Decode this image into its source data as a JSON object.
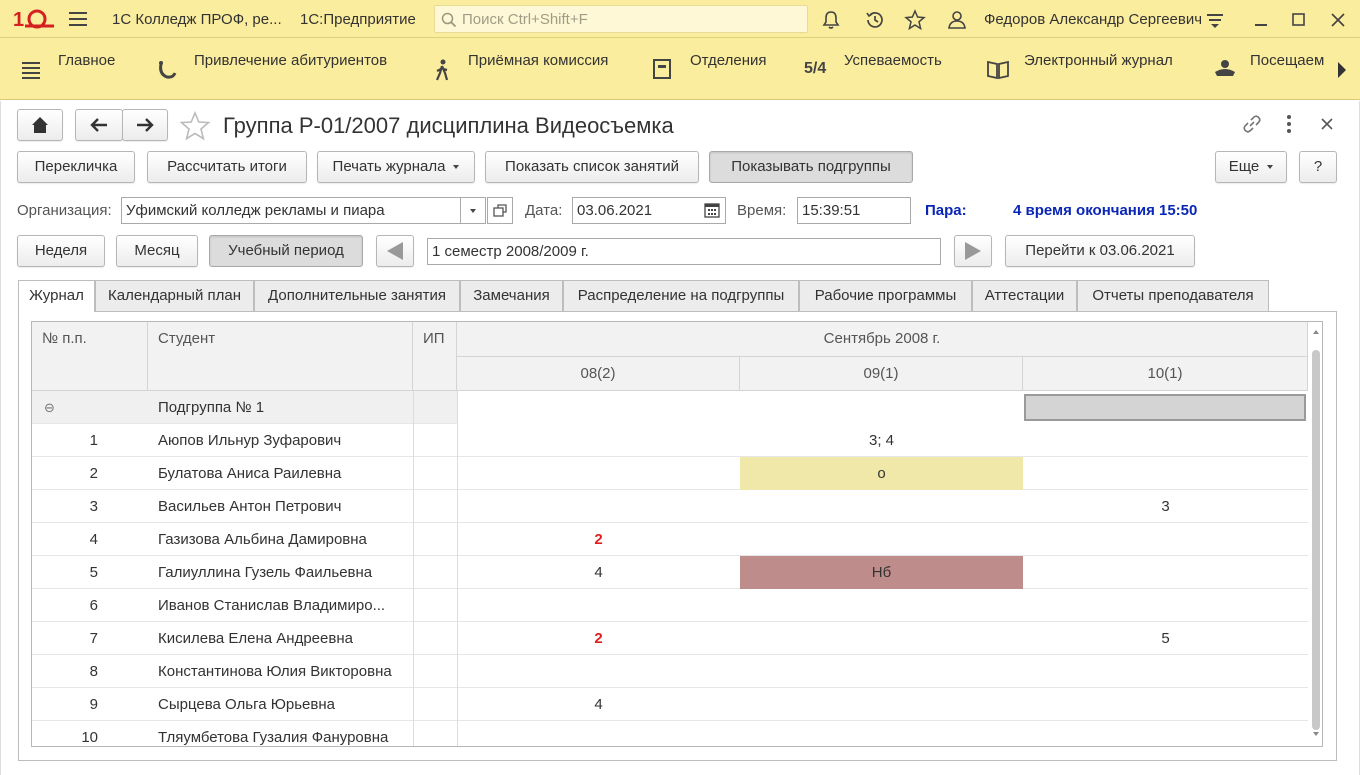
{
  "app": {
    "title": "1С Колледж ПРОФ, ре...",
    "subtitle": "1С:Предприятие",
    "search_placeholder": "Поиск Ctrl+Shift+F",
    "user": "Федоров Александр Сергеевич"
  },
  "sections": [
    {
      "label": "Главное",
      "icon": "list-icon"
    },
    {
      "label": "Привлечение абитуриентов",
      "icon": "magnet-icon"
    },
    {
      "label": "Приёмная комиссия",
      "icon": "person-walking-icon"
    },
    {
      "label": "Отделения",
      "icon": "building-icon"
    },
    {
      "label": "Успеваемость",
      "icon": "grade-icon",
      "glyph": "5/4"
    },
    {
      "label": "Электронный журнал",
      "icon": "book-icon"
    },
    {
      "label": "Посещаем",
      "icon": "hat-icon"
    }
  ],
  "form": {
    "title": "Группа Р-01/2007 дисциплина Видеосъемка",
    "buttons": {
      "rollcall": "Перекличка",
      "calc_totals": "Рассчитать итоги",
      "print_journal": "Печать журнала",
      "show_lessons": "Показать список занятий",
      "show_subgroups": "Показывать подгруппы",
      "more": "Еще",
      "help": "?"
    },
    "org_label": "Организация:",
    "org_value": "Уфимский колледж рекламы и пиара",
    "date_label": "Дата:",
    "date_value": "03.06.2021",
    "time_label": "Время:",
    "time_value": "15:39:51",
    "pair_label": "Пара:",
    "pair_value": "4 время окончания 15:50",
    "period_buttons": {
      "week": "Неделя",
      "month": "Месяц",
      "study_period": "Учебный период"
    },
    "period_value": "1 семестр 2008/2009 г.",
    "goto_label": "Перейти к 03.06.2021"
  },
  "tabs": [
    "Журнал",
    "Календарный план",
    "Дополнительные занятия",
    "Замечания",
    "Распределение на подгруппы",
    "Рабочие программы",
    "Аттестации",
    "Отчеты преподавателя"
  ],
  "grid": {
    "headers": {
      "num": "№ п.п.",
      "student": "Студент",
      "ip": "ИП",
      "month": "Сентябрь 2008 г."
    },
    "days": [
      "08(2)",
      "09(1)",
      "10(1)"
    ],
    "group_label": "Подгруппа № 1",
    "group_toggle": "⊖",
    "rows": [
      {
        "n": "1",
        "name": "Аюпов Ильнур Зуфарович",
        "d1": "",
        "d2": "3; 4",
        "d3": ""
      },
      {
        "n": "2",
        "name": "Булатова Аниса Раилевна",
        "d1": "",
        "d2": "о",
        "d3": ""
      },
      {
        "n": "3",
        "name": "Васильев Антон Петрович",
        "d1": "",
        "d2": "",
        "d3": "3"
      },
      {
        "n": "4",
        "name": "Газизова Альбина Дамировна",
        "d1": "2",
        "d2": "",
        "d3": ""
      },
      {
        "n": "5",
        "name": "Галиуллина Гузель Фаильевна",
        "d1": "4",
        "d2": "Нб",
        "d3": ""
      },
      {
        "n": "6",
        "name": "Иванов Станислав Владимиро...",
        "d1": "",
        "d2": "",
        "d3": ""
      },
      {
        "n": "7",
        "name": "Кисилева Елена Андреевна",
        "d1": "2",
        "d2": "",
        "d3": "5"
      },
      {
        "n": "8",
        "name": "Константинова Юлия Викторовна",
        "d1": "",
        "d2": "",
        "d3": ""
      },
      {
        "n": "9",
        "name": "Сырцева Ольга Юрьевна",
        "d1": "4",
        "d2": "",
        "d3": ""
      },
      {
        "n": "10",
        "name": "Тляумбетова Гузалия Фануровна",
        "d1": "",
        "d2": "",
        "d3": ""
      }
    ]
  },
  "colors": {
    "accent_yellow": "#fbed9e",
    "cell_highlight_yellow": "#f0e8a8",
    "cell_absent": "#bf8c8c",
    "mark_red": "#e21d1d",
    "pair_blue": "#0a26b6"
  }
}
